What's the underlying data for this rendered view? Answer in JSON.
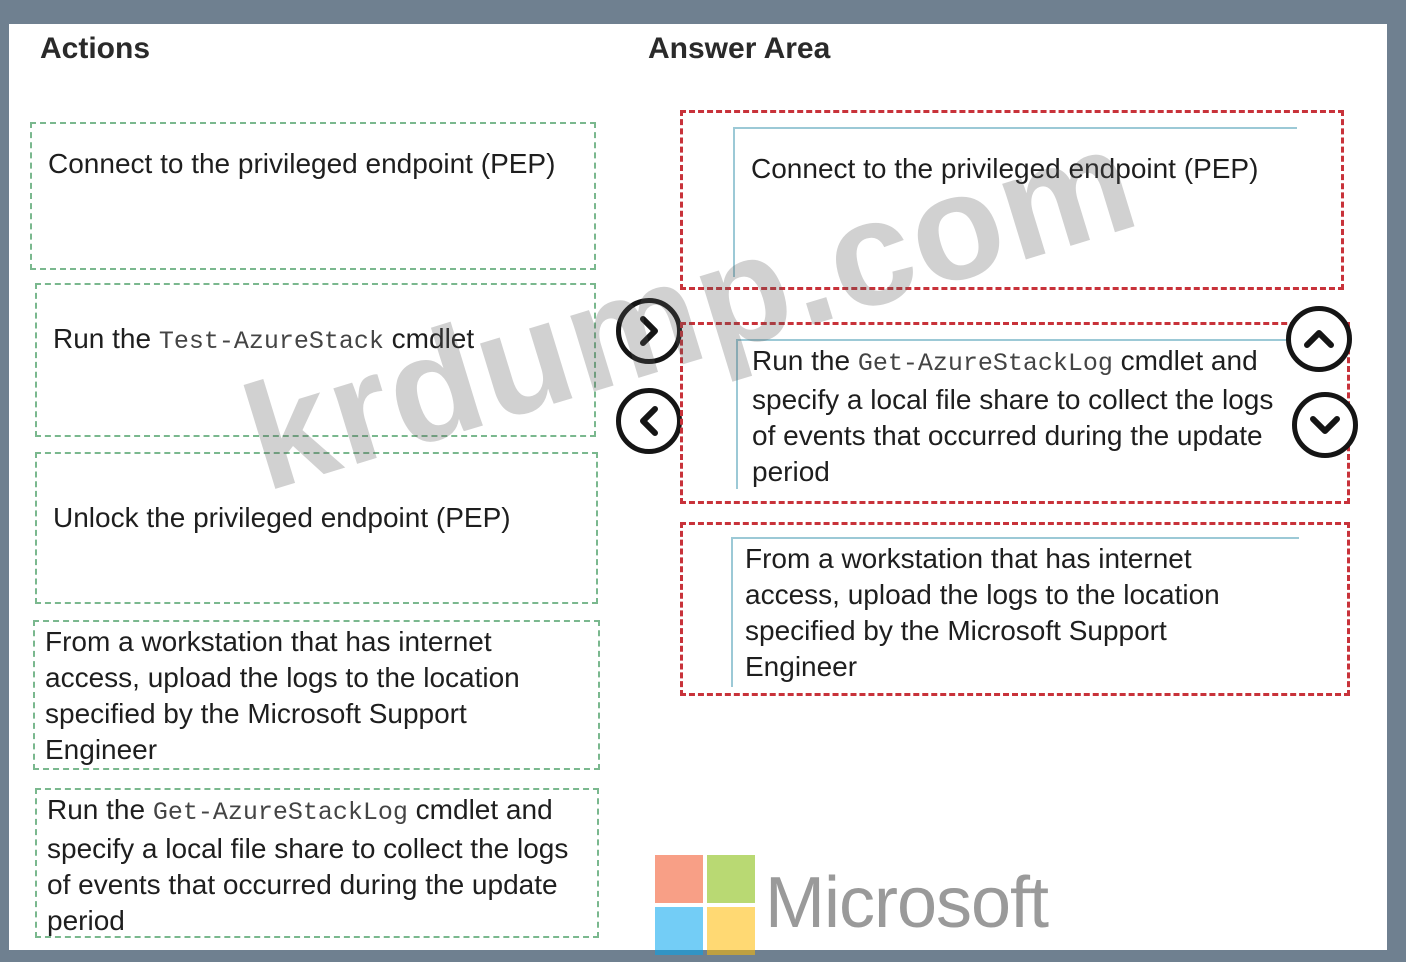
{
  "headings": {
    "actions": "Actions",
    "answer_area": "Answer Area"
  },
  "actions": {
    "connect_pep": "Connect to the privileged endpoint (PEP)",
    "run_test_prefix": "Run the ",
    "run_test_cmd": "Test-AzureStack",
    "run_test_suffix": " cmdlet",
    "unlock_pep": "Unlock the privileged endpoint (PEP)",
    "upload_logs": "From a workstation that has internet access, upload the logs to the location specified by the Microsoft Support Engineer",
    "run_getlog_prefix": "Run the ",
    "run_getlog_cmd": "Get-AzureStackLog",
    "run_getlog_suffix": " cmdlet and specify a local file share to collect the logs of events that occurred during the update period"
  },
  "answer": {
    "slot1": "Connect to the privileged endpoint (PEP)",
    "slot2_prefix": "Run the ",
    "slot2_cmd": "Get-AzureStackLog",
    "slot2_suffix": " cmdlet and specify a local file share to collect the logs of events that occurred during the update period",
    "slot3": "From a workstation that has internet access, upload the logs to the location specified by the Microsoft Support Engineer"
  },
  "icons": {
    "move_right": "chevron-right-icon",
    "move_left": "chevron-left-icon",
    "move_up": "chevron-up-icon",
    "move_down": "chevron-down-icon"
  },
  "watermark": "krdump.com",
  "logo": {
    "text": "Microsoft",
    "colors": [
      "#f25022",
      "#7fba00",
      "#00a4ef",
      "#ffb900"
    ]
  },
  "colors": {
    "action_border": "#7ab88e",
    "answer_border": "#c8323a",
    "inner_border": "#9cc9d6"
  }
}
